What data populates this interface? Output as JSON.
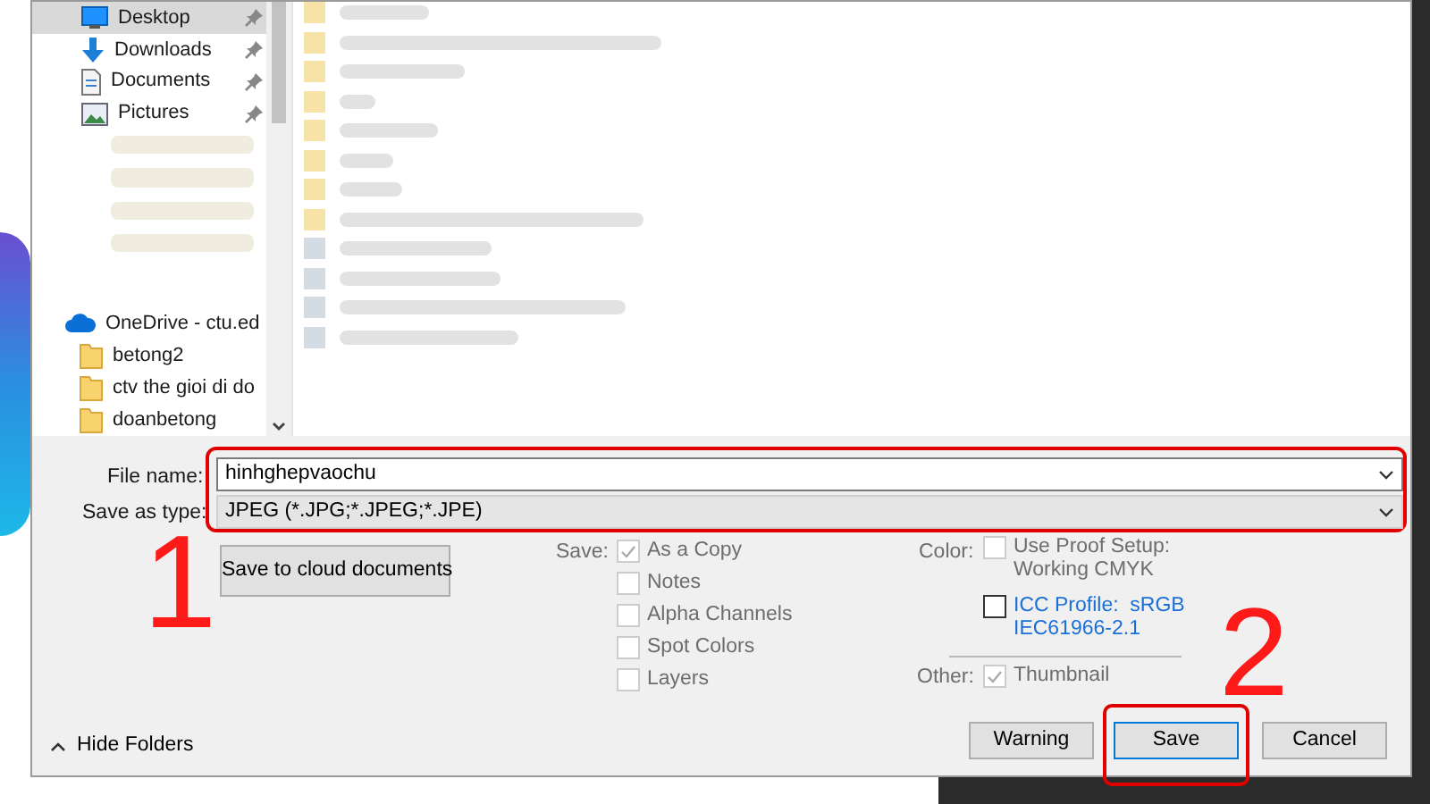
{
  "sidebar": {
    "items": [
      {
        "label": "Desktop",
        "kind": "desktop",
        "pinned": true,
        "selected": true
      },
      {
        "label": "Downloads",
        "kind": "download",
        "pinned": true,
        "selected": false
      },
      {
        "label": "Documents",
        "kind": "document",
        "pinned": true,
        "selected": false
      },
      {
        "label": "Pictures",
        "kind": "picture",
        "pinned": true,
        "selected": false
      },
      {
        "label": "OneDrive - ctu.ed",
        "kind": "cloud",
        "pinned": false,
        "selected": false
      },
      {
        "label": "betong2",
        "kind": "folder",
        "pinned": false,
        "selected": false
      },
      {
        "label": "ctv the gioi di do",
        "kind": "folder",
        "pinned": false,
        "selected": false
      },
      {
        "label": "doanbetong",
        "kind": "folder",
        "pinned": false,
        "selected": false
      }
    ]
  },
  "file_name": {
    "label": "File name:",
    "value": "hinhghepvaochu"
  },
  "save_as_type": {
    "label": "Save as type:",
    "value": "JPEG (*.JPG;*.JPEG;*.JPE)"
  },
  "cloud_button": "Save to cloud documents",
  "save_options": {
    "label": "Save:",
    "items": [
      {
        "label": "As a Copy",
        "checked": true,
        "disabled": true
      },
      {
        "label": "Notes",
        "checked": false,
        "disabled": true
      },
      {
        "label": "Alpha Channels",
        "checked": false,
        "disabled": true
      },
      {
        "label": "Spot Colors",
        "checked": false,
        "disabled": true
      },
      {
        "label": "Layers",
        "checked": false,
        "disabled": true
      }
    ]
  },
  "color_options": {
    "label": "Color:",
    "proof": {
      "label": "Use Proof Setup:",
      "sub": "Working CMYK",
      "checked": false,
      "disabled": true
    },
    "icc": {
      "label": "ICC Profile:  sRGB",
      "sub": "IEC61966-2.1",
      "checked": false,
      "disabled": false
    }
  },
  "other_options": {
    "label": "Other:",
    "thumbnail": {
      "label": "Thumbnail",
      "checked": true,
      "disabled": true
    }
  },
  "hide_folders": "Hide Folders",
  "buttons": [
    {
      "label": "Warning",
      "default": false
    },
    {
      "label": "Save",
      "default": true
    },
    {
      "label": "Cancel",
      "default": false
    }
  ],
  "annotations": [
    "1",
    "2"
  ]
}
